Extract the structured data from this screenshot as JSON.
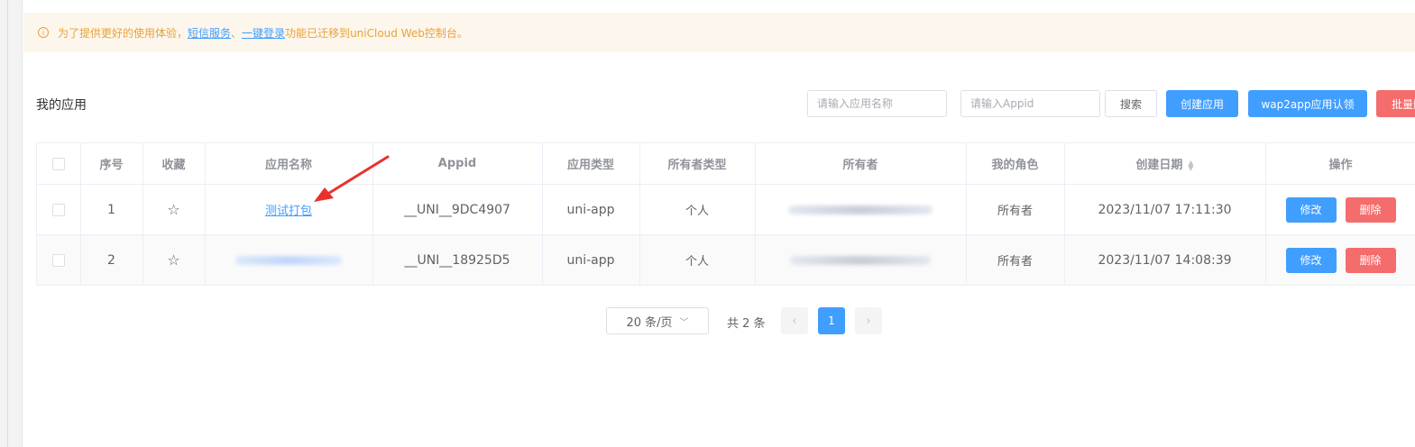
{
  "notice": {
    "prefix": "为了提供更好的使用体验，",
    "link1": "短信服务",
    "sep": "、",
    "link2": "一键登录",
    "suffix": "功能已迁移到uniCloud Web控制台。"
  },
  "toolbar": {
    "title": "我的应用",
    "app_name_placeholder": "请输入应用名称",
    "appid_placeholder": "请输入Appid",
    "search_label": "搜索",
    "create_label": "创建应用",
    "wap2app_label": "wap2app应用认领",
    "batch_label": "批量删除"
  },
  "table": {
    "headers": {
      "index": "序号",
      "favorite": "收藏",
      "app_name": "应用名称",
      "appid": "Appid",
      "app_type": "应用类型",
      "owner_type": "所有者类型",
      "owner": "所有者",
      "role": "我的角色",
      "created": "创建日期",
      "actions": "操作"
    },
    "rows": [
      {
        "index": "1",
        "app_name": "测试打包",
        "appid": "__UNI__9DC4907",
        "app_type": "uni-app",
        "owner_type": "个人",
        "role": "所有者",
        "created": "2023/11/07 17:11:30",
        "edit": "修改",
        "delete": "删除"
      },
      {
        "index": "2",
        "app_name": "",
        "appid": "__UNI__18925D5",
        "app_type": "uni-app",
        "owner_type": "个人",
        "role": "所有者",
        "created": "2023/11/07 14:08:39",
        "edit": "修改",
        "delete": "删除"
      }
    ]
  },
  "pagination": {
    "page_size": "20 条/页",
    "total": "共 2 条",
    "current_page": "1",
    "prev_icon": "chevron-left-icon",
    "next_icon": "chevron-right-icon"
  },
  "colors": {
    "primary": "#409eff",
    "danger": "#f56c6c",
    "warning_text": "#e6a23c",
    "notice_bg": "#fdf6ec",
    "annotation_arrow": "#e8322d"
  }
}
